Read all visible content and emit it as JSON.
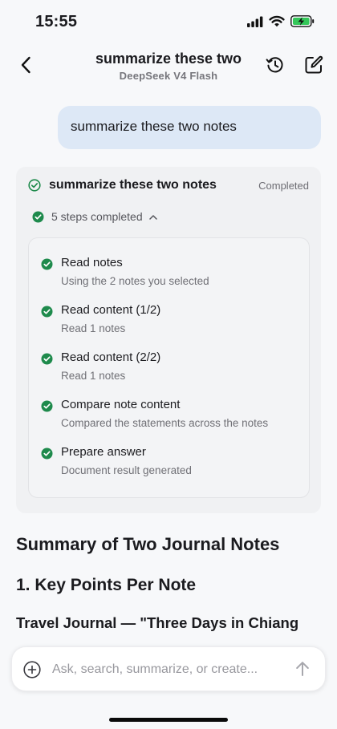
{
  "status_bar": {
    "time": "15:55",
    "icons": [
      "signal-icon",
      "wifi-icon",
      "battery-charging-icon"
    ],
    "battery_color": "#34c759"
  },
  "header": {
    "title": "summarize these two",
    "subtitle": "DeepSeek V4 Flash",
    "icons": [
      "back-chevron-icon",
      "history-icon",
      "compose-icon"
    ]
  },
  "user_message": {
    "text": "summarize these two notes",
    "bubble_color": "#dde8f6"
  },
  "task_card": {
    "title": "summarize these two notes",
    "status": "Completed",
    "steps_summary": "5 steps completed",
    "check_color": "#1e8a4c",
    "steps": [
      {
        "title": "Read notes",
        "detail": "Using the 2 notes you selected"
      },
      {
        "title": "Read content (1/2)",
        "detail": "Read 1 notes"
      },
      {
        "title": "Read content (2/2)",
        "detail": "Read 1 notes"
      },
      {
        "title": "Compare note content",
        "detail": "Compared the statements across the notes"
      },
      {
        "title": "Prepare answer",
        "detail": "Document result generated"
      }
    ]
  },
  "answer": {
    "heading": "Summary of Two Journal Notes",
    "section_heading": "1. Key Points Per Note",
    "subsection_heading": "Travel Journal — \"Three Days in Chiang"
  },
  "composer": {
    "placeholder": "Ask, search, summarize, or create...",
    "value": "",
    "icons": [
      "add-circle-icon",
      "send-arrow-icon"
    ]
  }
}
